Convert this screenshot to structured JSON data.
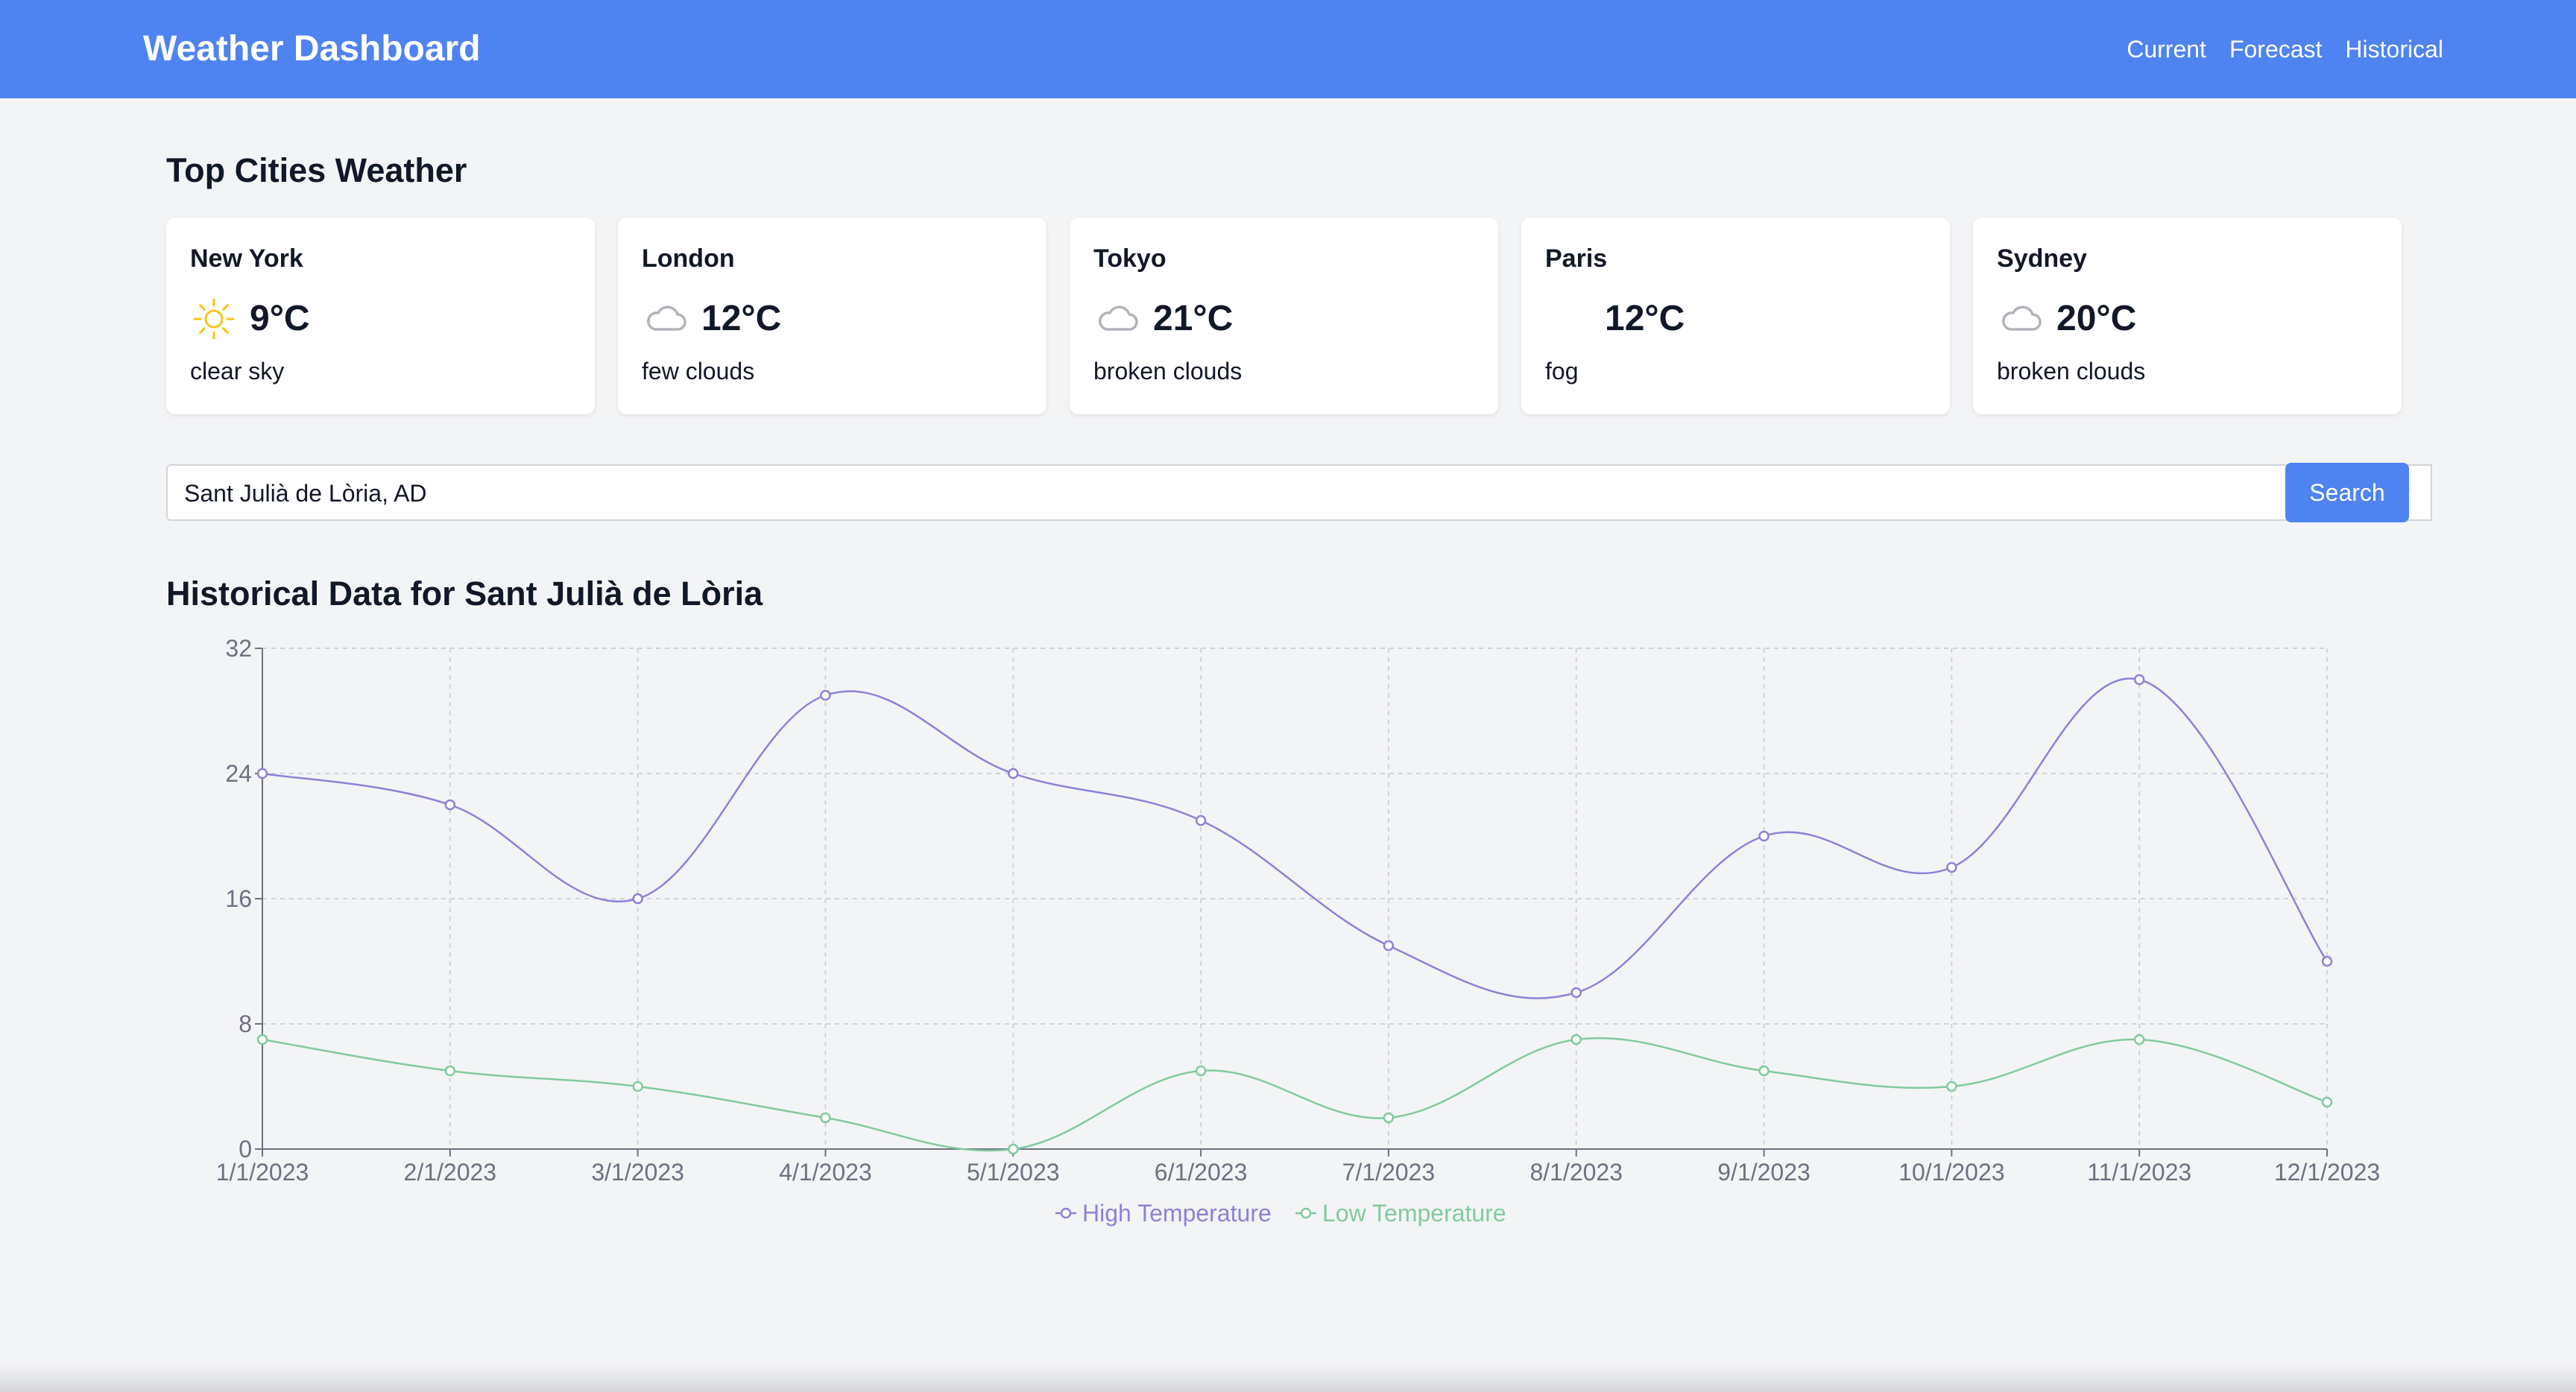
{
  "header": {
    "title": "Weather Dashboard",
    "nav": [
      "Current",
      "Forecast",
      "Historical"
    ]
  },
  "top_cities": {
    "title": "Top Cities Weather",
    "cities": [
      {
        "name": "New York",
        "temp": "9°C",
        "desc": "clear sky",
        "icon": "sun-icon"
      },
      {
        "name": "London",
        "temp": "12°C",
        "desc": "few clouds",
        "icon": "cloud-icon"
      },
      {
        "name": "Tokyo",
        "temp": "21°C",
        "desc": "broken clouds",
        "icon": "cloud-icon"
      },
      {
        "name": "Paris",
        "temp": "12°C",
        "desc": "fog",
        "icon": "none"
      },
      {
        "name": "Sydney",
        "temp": "20°C",
        "desc": "broken clouds",
        "icon": "cloud-icon"
      }
    ]
  },
  "search": {
    "value": "Sant Julià de Lòria, AD",
    "button_label": "Search"
  },
  "historical": {
    "title": "Historical Data for Sant Julià de Lòria"
  },
  "colors": {
    "primary": "#4f83ef",
    "high": "#8884d8",
    "low": "#82ca9d"
  },
  "chart_data": {
    "type": "line",
    "x": [
      "1/1/2023",
      "2/1/2023",
      "3/1/2023",
      "4/1/2023",
      "5/1/2023",
      "6/1/2023",
      "7/1/2023",
      "8/1/2023",
      "9/1/2023",
      "10/1/2023",
      "11/1/2023",
      "12/1/2023"
    ],
    "series": [
      {
        "name": "High Temperature",
        "values": [
          24,
          22,
          16,
          29,
          24,
          21,
          13,
          10,
          20,
          18,
          30,
          12
        ]
      },
      {
        "name": "Low Temperature",
        "values": [
          7,
          5,
          4,
          2,
          0,
          5,
          2,
          7,
          5,
          4,
          7,
          3
        ]
      }
    ],
    "ylim": [
      0,
      32
    ],
    "yticks": [
      0,
      8,
      16,
      24,
      32
    ],
    "grid": true,
    "legend": "bottom-center"
  }
}
